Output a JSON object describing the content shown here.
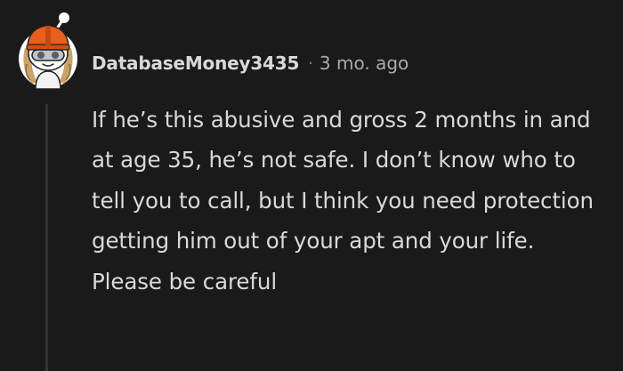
{
  "comment": {
    "username": "DatabaseMoney3435",
    "separator": "·",
    "timestamp": "3 mo. ago",
    "body": "If he’s this abusive and gross 2 months in and at age 35, he’s not safe. I don’t know who to tell you to call, but I think you need protection getting him out of your apt and your life. Please be careful"
  },
  "avatar": {
    "icon": "snoo-avatar-icon",
    "colors": {
      "helmet": "#e8601c",
      "face": "#ffffff",
      "hair": "#c9a36a",
      "goggles": "#bfc4c9"
    }
  },
  "theme": {
    "background": "#1a1a1b",
    "text": "#d7dadc",
    "muted": "#a8aaab",
    "thread_line": "#343536"
  }
}
